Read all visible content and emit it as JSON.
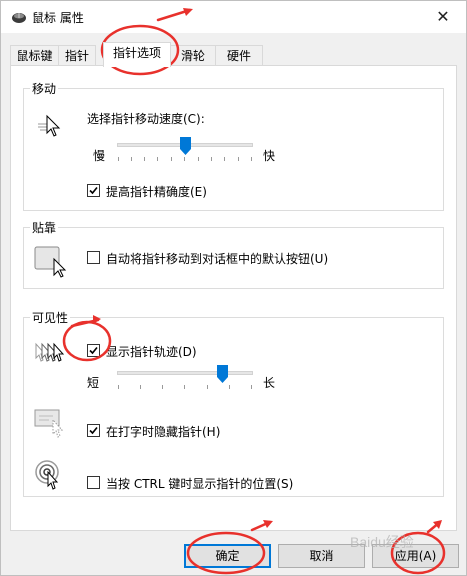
{
  "window": {
    "title": "鼠标 属性",
    "close_glyph": "✕",
    "watermark": "Baidu经验"
  },
  "tabs": [
    {
      "label": "鼠标键",
      "active": false
    },
    {
      "label": "指针",
      "active": false
    },
    {
      "label": "指针选项",
      "active": true
    },
    {
      "label": "滑轮",
      "active": false
    },
    {
      "label": "硬件",
      "active": false
    }
  ],
  "motion": {
    "legend": "移动",
    "speed_label": "选择指针移动速度(C):",
    "slow_label": "慢",
    "fast_label": "快",
    "speed_value": 0.5,
    "precision_label": "提高指针精确度(E)",
    "precision_checked": true
  },
  "snap": {
    "legend": "贴靠",
    "snap_label": "自动将指针移动到对话框中的默认按钮(U)",
    "snap_checked": false
  },
  "visibility": {
    "legend": "可见性",
    "trails_label": "显示指针轨迹(D)",
    "trails_checked": true,
    "short_label": "短",
    "long_label": "长",
    "trails_value": 0.8,
    "hide_label": "在打字时隐藏指针(H)",
    "hide_checked": true,
    "ctrl_label": "当按 CTRL 键时显示指针的位置(S)",
    "ctrl_checked": false
  },
  "buttons": {
    "ok": "确定",
    "cancel": "取消",
    "apply": "应用(A)"
  },
  "colors": {
    "accent": "#0078d7",
    "annotation": "#e8312c"
  },
  "icons": {
    "title": "mouse-icon",
    "motion": "pointer-motion-icon",
    "snap": "snap-to-button-icon",
    "trails": "pointer-trails-icon",
    "hide": "hide-while-typing-icon",
    "ctrl": "show-location-icon"
  }
}
